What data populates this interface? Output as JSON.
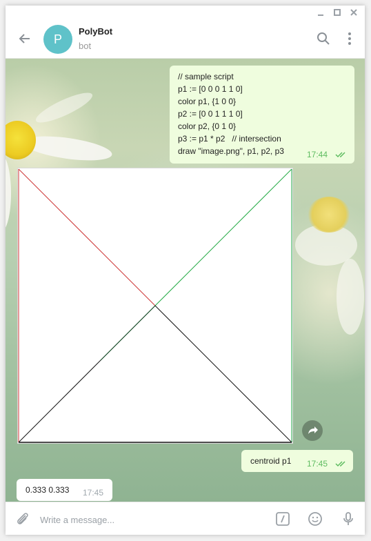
{
  "window": {
    "controls": {
      "minimize_icon": "minimize-icon",
      "maximize_icon": "maximize-icon",
      "close_icon": "close-icon"
    }
  },
  "header": {
    "avatar_letter": "P",
    "title": "PolyBot",
    "subtitle": "bot",
    "icons": [
      "back-arrow-icon",
      "search-icon",
      "more-vertical-icon"
    ]
  },
  "colors": {
    "avatar": "#5fc2c9",
    "outgoing_bubble": "#effdde",
    "incoming_bubble": "#ffffff",
    "time_out": "#5ebc60",
    "time_in": "#a0a8ae",
    "line_red": "#cc3333",
    "line_green": "#22aa44",
    "line_black": "#111111"
  },
  "messages": [
    {
      "direction": "outgoing",
      "lines": [
        "// sample script",
        "p1 := [0 0 0 1 1 0]",
        "color p1, {1 0 0}",
        "p2 := [0 0 1 1 1 0]",
        "color p2, {0 1 0}",
        "p3 := p1 * p2   // intersection",
        "draw \"image.png\", p1, p2, p3"
      ],
      "time": "17:44",
      "read": true
    },
    {
      "direction": "incoming",
      "type": "image",
      "share_icon": "share-icon"
    },
    {
      "direction": "outgoing",
      "text": "centroid p1",
      "time": "17:45",
      "read": true
    },
    {
      "direction": "incoming",
      "text": "0.333 0.333",
      "time": "17:45"
    }
  ],
  "input": {
    "placeholder": "Write a message...",
    "icons": [
      "attach-icon",
      "bot-command-icon",
      "emoji-icon",
      "microphone-icon"
    ]
  }
}
